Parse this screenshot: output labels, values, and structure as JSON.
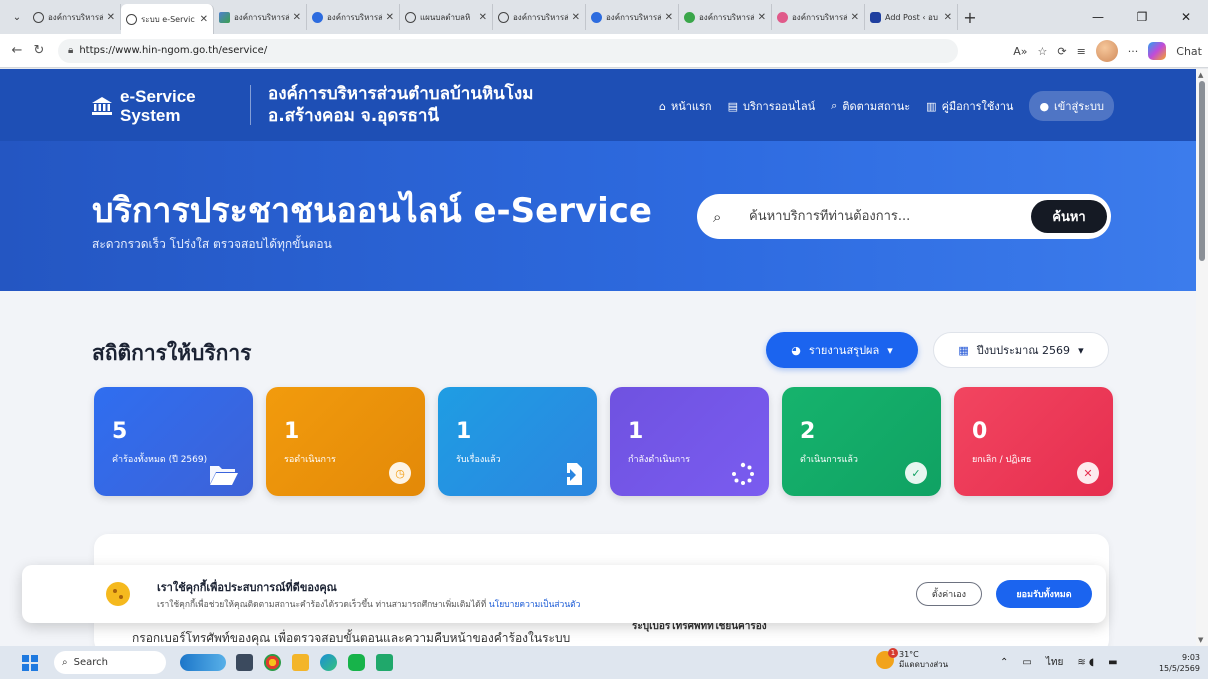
{
  "browser": {
    "tabs": [
      {
        "title": "องค์การบริหารส่",
        "icon": "globe-icon"
      },
      {
        "title": "ระบบ e-Servic",
        "icon": "globe-icon",
        "active": true
      },
      {
        "title": "องค์การบริหารส่",
        "icon": "image-icon"
      },
      {
        "title": "องค์การบริหารส่",
        "icon": "wordpress-icon"
      },
      {
        "title": "แผนบลตำบลหิ",
        "icon": "globe-icon"
      },
      {
        "title": "องค์การบริหารส่",
        "icon": "globe-icon"
      },
      {
        "title": "องค์การบริหารส่",
        "icon": "site-icon"
      },
      {
        "title": "องค์การบริหารส่",
        "icon": "site-icon"
      },
      {
        "title": "องค์การบริหารส่",
        "icon": "site-icon"
      },
      {
        "title": "Add Post ‹ อบ",
        "icon": "wp-admin-icon"
      }
    ],
    "url": "https://www.hin-ngom.go.th/eservice/",
    "chat_label": "Chat"
  },
  "site": {
    "brand": {
      "line1": "e-Service",
      "line2": "System"
    },
    "org": {
      "line1": "องค์การบริหารส่วนตำบลบ้านหินโงม",
      "line2": "อ.สร้างคอม จ.อุดรธานี"
    },
    "nav": [
      {
        "label": "หน้าแรก",
        "icon": "home-icon"
      },
      {
        "label": "บริการออนไลน์",
        "icon": "file-icon"
      },
      {
        "label": "ติดตามสถานะ",
        "icon": "search-icon"
      },
      {
        "label": "คู่มือการใช้งาน",
        "icon": "book-icon"
      },
      {
        "label": "เข้าสู่ระบบ",
        "icon": "user-icon"
      }
    ]
  },
  "hero": {
    "title": "บริการประชาชนออนไลน์ e-Service",
    "subtitle": "สะดวกรวดเร็ว โปร่งใส ตรวจสอบได้ทุกขั้นตอน",
    "search_placeholder": "ค้นหาบริการที่ท่านต้องการ...",
    "search_button": "ค้นหา"
  },
  "stats": {
    "title": "สถิติการให้บริการ",
    "report_button": "รายงานสรุปผล",
    "year_button": "ปีงบประมาณ 2569",
    "cards": [
      {
        "value": "5",
        "label": "คำร้องทั้งหมด (ปี 2569)",
        "icon": "folder-open-icon",
        "color": "#2f6ef0"
      },
      {
        "value": "1",
        "label": "รอดำเนินการ",
        "icon": "clock-icon",
        "color": "#f29b0d"
      },
      {
        "value": "1",
        "label": "รับเรื่องแล้ว",
        "icon": "file-import-icon",
        "color": "#1f9de3"
      },
      {
        "value": "1",
        "label": "กำลังดำเนินการ",
        "icon": "spinner-icon",
        "color": "#6f52e0"
      },
      {
        "value": "2",
        "label": "ดำเนินการแล้ว",
        "icon": "check-circle-icon",
        "color": "#16b36d"
      },
      {
        "value": "0",
        "label": "ยกเลิก / ปฏิเสธ",
        "icon": "x-circle-icon",
        "color": "#f24560"
      }
    ]
  },
  "lower": {
    "text_left": "กรอกเบอร์โทรศัพท์ของคุณ เพื่อตรวจสอบขั้นตอนและความคืบหน้าของคำร้องในระบบ",
    "text_right": "ระบุเบอร์โทรศัพท์ที่ใช้ยื่นคำร้อง"
  },
  "cookie": {
    "title": "เราใช้คุกกี้เพื่อประสบการณ์ที่ดีของคุณ",
    "desc": "เราใช้คุกกี้เพื่อช่วยให้คุณติดตามสถานะคำร้องได้รวดเร็วขึ้น ท่านสามารถศึกษาเพิ่มเติมได้ที่ ",
    "link": "นโยบายความเป็นส่วนตัว",
    "settings_button": "ตั้งค่าเอง",
    "accept_button": "ยอมรับทั้งหมด"
  },
  "taskbar": {
    "search_label": "Search",
    "weather_temp": "31°C",
    "weather_desc": "มีแดดบางส่วน",
    "weather_badge": "1",
    "lang": "ไทย",
    "time": "9:03",
    "date": "15/5/2569"
  }
}
